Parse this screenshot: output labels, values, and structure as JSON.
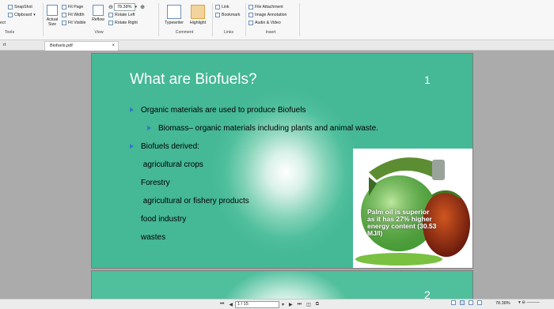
{
  "ribbon": {
    "tools": {
      "snapshot": "SnapShot",
      "clipboard": "Clipboard",
      "select": "ect",
      "label": "Tools"
    },
    "view": {
      "actual_size": "Actual Size",
      "fit_page": "Fit Page",
      "fit_width": "Fit Width",
      "fit_visible": "Fit Visible",
      "reflow": "Reflow",
      "zoom_value": "78.38%",
      "rotate_left": "Rotate Left",
      "rotate_right": "Rotate Right",
      "label": "View"
    },
    "comment": {
      "typewriter": "Typewriter",
      "highlight": "Highlight",
      "label": "Comment"
    },
    "links": {
      "link": "Link",
      "bookmark": "Bookmark",
      "label": "Links"
    },
    "insert": {
      "file_attachment": "File Attachment",
      "image_annotation": "Image Annotation",
      "audio_video": "Audio & Video",
      "label": "Insert"
    }
  },
  "tabs": [
    {
      "label": "rt"
    },
    {
      "label": "Biofuels.pdf"
    }
  ],
  "slide1": {
    "title": "What are Biofuels?",
    "page_number": "1",
    "bullets": [
      "Organic materials are used to produce Biofuels",
      "Biomass– organic materials including plants and animal waste.",
      "Biofuels derived:",
      " agricultural crops",
      "Forestry",
      " agricultural or fishery products",
      "food industry",
      "wastes"
    ],
    "image_caption": "Palm oil is superior as it has 27% higher energy content (30.53 MJ/l)"
  },
  "slide2": {
    "page_number": "2"
  },
  "status": {
    "page_indicator": "1 / 15",
    "zoom": "78.38%"
  },
  "colors": {
    "slide_green": "#45b895",
    "bullet_blue": "#2e78c7",
    "highlight": "#f2d39b"
  }
}
